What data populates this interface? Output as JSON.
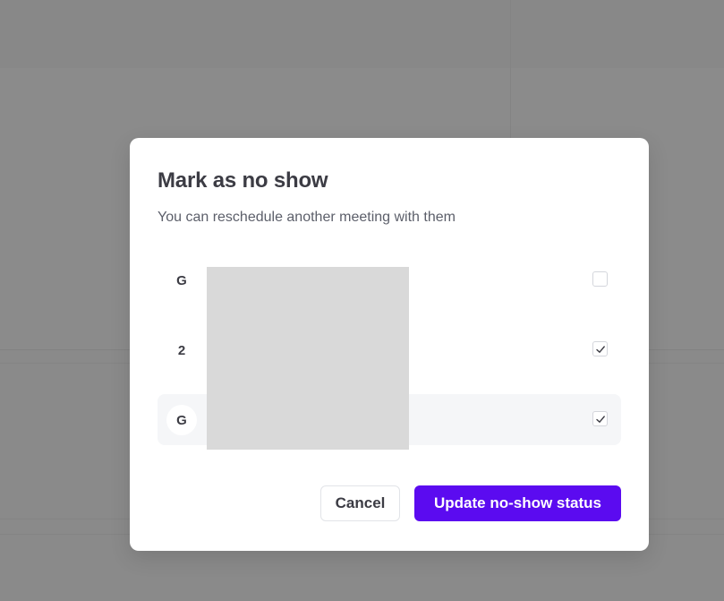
{
  "dialog": {
    "title": "Mark as no show",
    "subtitle": "You can reschedule another meeting with them",
    "attendees": [
      {
        "initial": "G",
        "name": "",
        "checked": false,
        "selected": false
      },
      {
        "initial": "2",
        "name": "",
        "checked": true,
        "selected": false
      },
      {
        "initial": "G",
        "name": "",
        "checked": true,
        "selected": true
      }
    ],
    "cancel_label": "Cancel",
    "submit_label": "Update no-show status"
  },
  "colors": {
    "primary": "#5b0bf0",
    "overlay": "#8a8a8a",
    "text": "#3c3c44"
  }
}
